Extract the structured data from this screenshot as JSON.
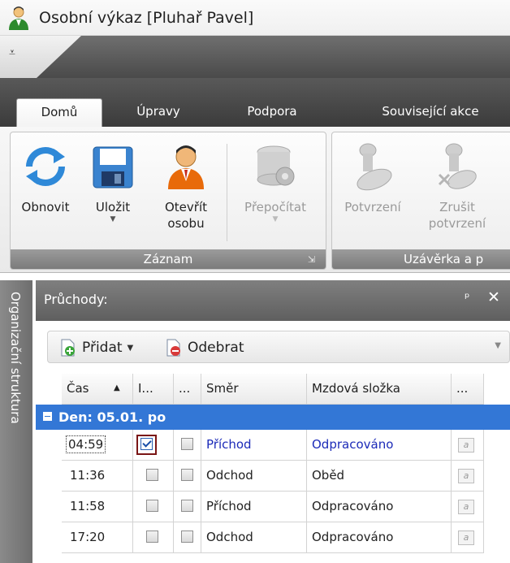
{
  "window": {
    "title": "Osobní výkaz [Pluhař Pavel]"
  },
  "tabs": [
    {
      "label": "Domů",
      "active": true
    },
    {
      "label": "Úpravy",
      "active": false
    },
    {
      "label": "Podpora",
      "active": false
    },
    {
      "label": "Související akce",
      "active": false
    }
  ],
  "ribbon": {
    "groups": [
      {
        "label": "Záznam",
        "buttons": [
          {
            "line1": "Obnovit",
            "line2": "",
            "icon": "refresh-icon",
            "enabled": true
          },
          {
            "line1": "Uložit",
            "line2": "",
            "icon": "save-icon",
            "enabled": true,
            "dropdown": true
          },
          {
            "line1": "Otevřít",
            "line2": "osobu",
            "icon": "person-icon",
            "enabled": true
          },
          {
            "line1": "Přepočítat",
            "line2": "",
            "icon": "recalculate-icon",
            "enabled": false,
            "dropdown": true
          }
        ]
      },
      {
        "label": "Uzávěrka a p",
        "buttons": [
          {
            "line1": "Potvrzení",
            "line2": "",
            "icon": "stamp-icon",
            "enabled": false
          },
          {
            "line1": "Zrušit",
            "line2": "potvrzení",
            "icon": "stamp-cancel-icon",
            "enabled": false
          }
        ]
      }
    ]
  },
  "sidebar": {
    "vertical_tab": "Organizační struktura"
  },
  "panel": {
    "title": "Průchody:",
    "toolbar": {
      "add_label": "Přidat",
      "remove_label": "Odebrat"
    },
    "columns": [
      "Čas",
      "I...",
      "...",
      "Směr",
      "Mzdová složka",
      "..."
    ],
    "group": "Den: 05.01. po",
    "rows": [
      {
        "time": "04:59",
        "c1": true,
        "c2": false,
        "direction": "Příchod",
        "wage": "Odpracováno",
        "blue": true
      },
      {
        "time": "11:36",
        "c1": false,
        "c2": false,
        "direction": "Odchod",
        "wage": "Oběd",
        "blue": false
      },
      {
        "time": "11:58",
        "c1": false,
        "c2": false,
        "direction": "Příchod",
        "wage": "Odpracováno",
        "blue": false
      },
      {
        "time": "17:20",
        "c1": false,
        "c2": false,
        "direction": "Odchod",
        "wage": "Odpracováno",
        "blue": false
      }
    ]
  },
  "colors": {
    "group_row": "#3377d6",
    "focus_border": "#7a1515",
    "link_blue": "#1c2bb8"
  }
}
